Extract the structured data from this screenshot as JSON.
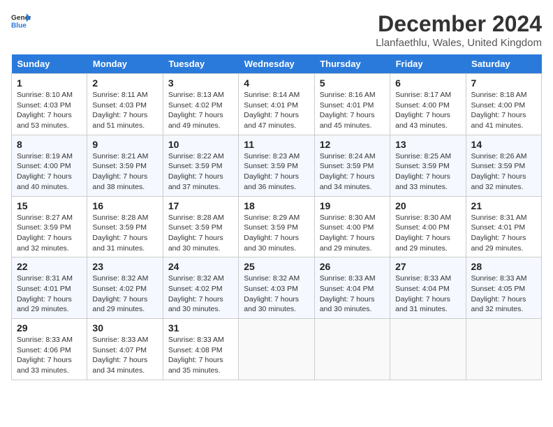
{
  "logo": {
    "line1": "General",
    "line2": "Blue"
  },
  "title": "December 2024",
  "subtitle": "Llanfaethlu, Wales, United Kingdom",
  "days_of_week": [
    "Sunday",
    "Monday",
    "Tuesday",
    "Wednesday",
    "Thursday",
    "Friday",
    "Saturday"
  ],
  "weeks": [
    [
      {
        "day": 1,
        "lines": [
          "Sunrise: 8:10 AM",
          "Sunset: 4:03 PM",
          "Daylight: 7 hours",
          "and 53 minutes."
        ]
      },
      {
        "day": 2,
        "lines": [
          "Sunrise: 8:11 AM",
          "Sunset: 4:03 PM",
          "Daylight: 7 hours",
          "and 51 minutes."
        ]
      },
      {
        "day": 3,
        "lines": [
          "Sunrise: 8:13 AM",
          "Sunset: 4:02 PM",
          "Daylight: 7 hours",
          "and 49 minutes."
        ]
      },
      {
        "day": 4,
        "lines": [
          "Sunrise: 8:14 AM",
          "Sunset: 4:01 PM",
          "Daylight: 7 hours",
          "and 47 minutes."
        ]
      },
      {
        "day": 5,
        "lines": [
          "Sunrise: 8:16 AM",
          "Sunset: 4:01 PM",
          "Daylight: 7 hours",
          "and 45 minutes."
        ]
      },
      {
        "day": 6,
        "lines": [
          "Sunrise: 8:17 AM",
          "Sunset: 4:00 PM",
          "Daylight: 7 hours",
          "and 43 minutes."
        ]
      },
      {
        "day": 7,
        "lines": [
          "Sunrise: 8:18 AM",
          "Sunset: 4:00 PM",
          "Daylight: 7 hours",
          "and 41 minutes."
        ]
      }
    ],
    [
      {
        "day": 8,
        "lines": [
          "Sunrise: 8:19 AM",
          "Sunset: 4:00 PM",
          "Daylight: 7 hours",
          "and 40 minutes."
        ]
      },
      {
        "day": 9,
        "lines": [
          "Sunrise: 8:21 AM",
          "Sunset: 3:59 PM",
          "Daylight: 7 hours",
          "and 38 minutes."
        ]
      },
      {
        "day": 10,
        "lines": [
          "Sunrise: 8:22 AM",
          "Sunset: 3:59 PM",
          "Daylight: 7 hours",
          "and 37 minutes."
        ]
      },
      {
        "day": 11,
        "lines": [
          "Sunrise: 8:23 AM",
          "Sunset: 3:59 PM",
          "Daylight: 7 hours",
          "and 36 minutes."
        ]
      },
      {
        "day": 12,
        "lines": [
          "Sunrise: 8:24 AM",
          "Sunset: 3:59 PM",
          "Daylight: 7 hours",
          "and 34 minutes."
        ]
      },
      {
        "day": 13,
        "lines": [
          "Sunrise: 8:25 AM",
          "Sunset: 3:59 PM",
          "Daylight: 7 hours",
          "and 33 minutes."
        ]
      },
      {
        "day": 14,
        "lines": [
          "Sunrise: 8:26 AM",
          "Sunset: 3:59 PM",
          "Daylight: 7 hours",
          "and 32 minutes."
        ]
      }
    ],
    [
      {
        "day": 15,
        "lines": [
          "Sunrise: 8:27 AM",
          "Sunset: 3:59 PM",
          "Daylight: 7 hours",
          "and 32 minutes."
        ]
      },
      {
        "day": 16,
        "lines": [
          "Sunrise: 8:28 AM",
          "Sunset: 3:59 PM",
          "Daylight: 7 hours",
          "and 31 minutes."
        ]
      },
      {
        "day": 17,
        "lines": [
          "Sunrise: 8:28 AM",
          "Sunset: 3:59 PM",
          "Daylight: 7 hours",
          "and 30 minutes."
        ]
      },
      {
        "day": 18,
        "lines": [
          "Sunrise: 8:29 AM",
          "Sunset: 3:59 PM",
          "Daylight: 7 hours",
          "and 30 minutes."
        ]
      },
      {
        "day": 19,
        "lines": [
          "Sunrise: 8:30 AM",
          "Sunset: 4:00 PM",
          "Daylight: 7 hours",
          "and 29 minutes."
        ]
      },
      {
        "day": 20,
        "lines": [
          "Sunrise: 8:30 AM",
          "Sunset: 4:00 PM",
          "Daylight: 7 hours",
          "and 29 minutes."
        ]
      },
      {
        "day": 21,
        "lines": [
          "Sunrise: 8:31 AM",
          "Sunset: 4:01 PM",
          "Daylight: 7 hours",
          "and 29 minutes."
        ]
      }
    ],
    [
      {
        "day": 22,
        "lines": [
          "Sunrise: 8:31 AM",
          "Sunset: 4:01 PM",
          "Daylight: 7 hours",
          "and 29 minutes."
        ]
      },
      {
        "day": 23,
        "lines": [
          "Sunrise: 8:32 AM",
          "Sunset: 4:02 PM",
          "Daylight: 7 hours",
          "and 29 minutes."
        ]
      },
      {
        "day": 24,
        "lines": [
          "Sunrise: 8:32 AM",
          "Sunset: 4:02 PM",
          "Daylight: 7 hours",
          "and 30 minutes."
        ]
      },
      {
        "day": 25,
        "lines": [
          "Sunrise: 8:32 AM",
          "Sunset: 4:03 PM",
          "Daylight: 7 hours",
          "and 30 minutes."
        ]
      },
      {
        "day": 26,
        "lines": [
          "Sunrise: 8:33 AM",
          "Sunset: 4:04 PM",
          "Daylight: 7 hours",
          "and 30 minutes."
        ]
      },
      {
        "day": 27,
        "lines": [
          "Sunrise: 8:33 AM",
          "Sunset: 4:04 PM",
          "Daylight: 7 hours",
          "and 31 minutes."
        ]
      },
      {
        "day": 28,
        "lines": [
          "Sunrise: 8:33 AM",
          "Sunset: 4:05 PM",
          "Daylight: 7 hours",
          "and 32 minutes."
        ]
      }
    ],
    [
      {
        "day": 29,
        "lines": [
          "Sunrise: 8:33 AM",
          "Sunset: 4:06 PM",
          "Daylight: 7 hours",
          "and 33 minutes."
        ]
      },
      {
        "day": 30,
        "lines": [
          "Sunrise: 8:33 AM",
          "Sunset: 4:07 PM",
          "Daylight: 7 hours",
          "and 34 minutes."
        ]
      },
      {
        "day": 31,
        "lines": [
          "Sunrise: 8:33 AM",
          "Sunset: 4:08 PM",
          "Daylight: 7 hours",
          "and 35 minutes."
        ]
      },
      null,
      null,
      null,
      null
    ]
  ]
}
